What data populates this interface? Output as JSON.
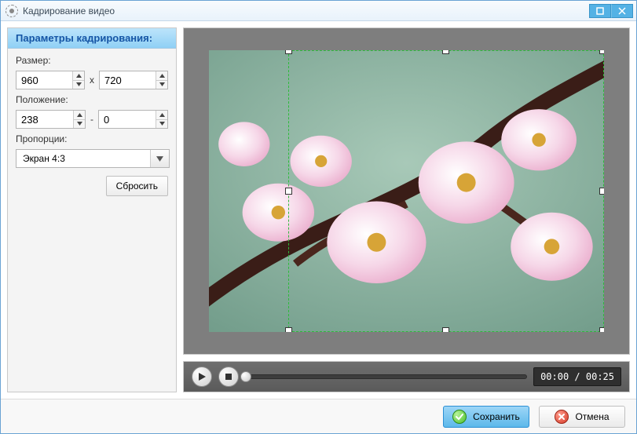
{
  "window": {
    "title": "Кадрирование видео"
  },
  "panel": {
    "header": "Параметры кадрирования:",
    "size_label": "Размер:",
    "size_sep": "x",
    "width": "960",
    "height": "720",
    "position_label": "Положение:",
    "pos_sep": "-",
    "pos_x": "238",
    "pos_y": "0",
    "aspect_label": "Пропорции:",
    "aspect_value": "Экран 4:3",
    "reset_label": "Сбросить"
  },
  "player": {
    "time": "00:00 / 00:25"
  },
  "footer": {
    "save": "Сохранить",
    "cancel": "Отмена"
  }
}
